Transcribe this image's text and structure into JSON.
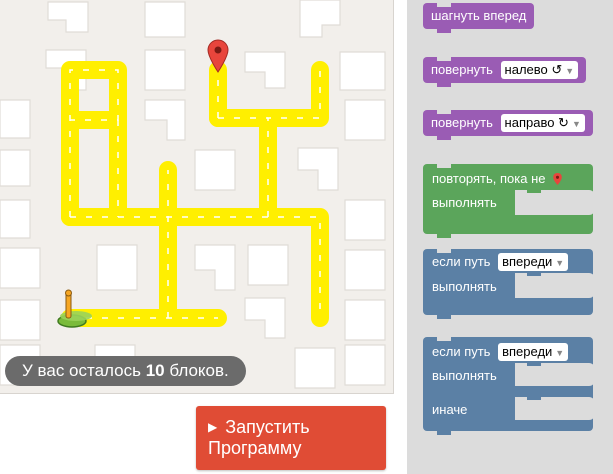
{
  "blocks_left": {
    "prefix": "У вас осталось",
    "count": "10",
    "suffix": "блоков."
  },
  "run_button": {
    "line1": "Запустить",
    "line2": "Программу"
  },
  "toolbox": {
    "move_forward": "шагнуть вперед",
    "turn_label": "повернуть",
    "turn_left_option": "налево ↺",
    "turn_right_option": "направо ↻",
    "repeat_until": "повторять, пока не",
    "do_label": "выполнять",
    "if_path": "если путь",
    "path_option": "впереди",
    "else_label": "иначе"
  },
  "colors": {
    "path": "#ffef00",
    "maze_bg": "#f2efeb",
    "run_button": "#e04c35",
    "movement_blocks": "#9a5cb4",
    "loop_block": "#5ba55b",
    "logic_blocks": "#5b80a5"
  },
  "icons": {
    "goal": "map-marker-icon",
    "start": "pegman-icon",
    "play": "play-icon",
    "dropdown": "chevron-down-icon"
  }
}
